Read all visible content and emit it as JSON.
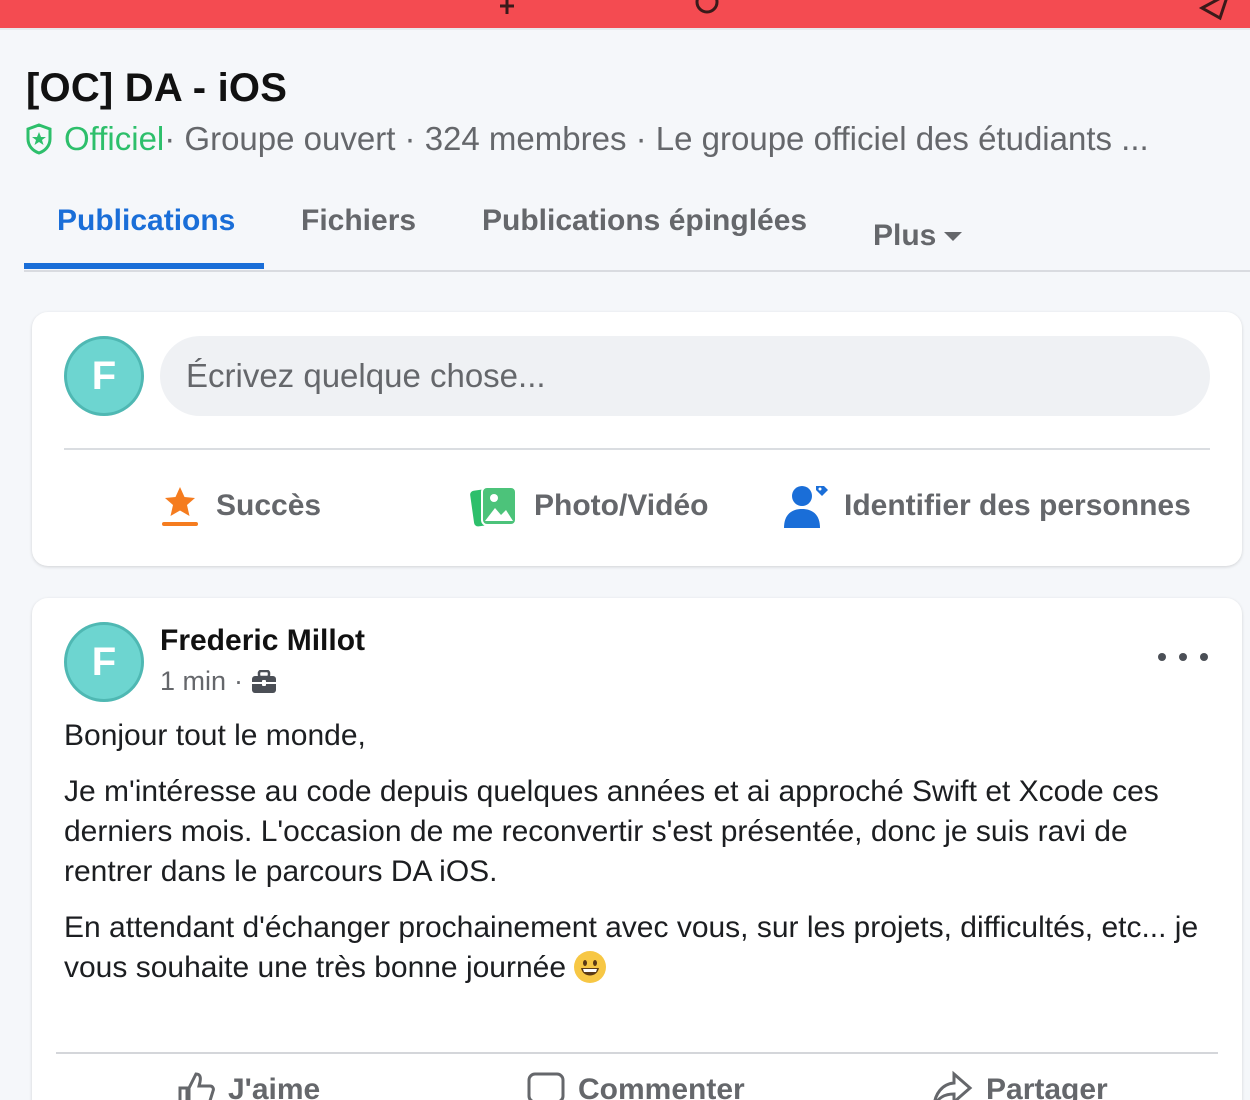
{
  "status_bar": {
    "color": "#f44b51"
  },
  "group": {
    "title": "[OC] DA - iOS",
    "official_label": "Officiel",
    "meta": " · Groupe ouvert · 324 membres · Le groupe officiel des étudiants ..."
  },
  "tabs": [
    {
      "label": "Publications",
      "active": true
    },
    {
      "label": "Fichiers"
    },
    {
      "label": "Publications épinglées"
    },
    {
      "label": "Plus"
    }
  ],
  "composer": {
    "avatar_initial": "F",
    "placeholder": "Écrivez quelque chose...",
    "actions": [
      {
        "label": "Succès",
        "icon": "star-badge-icon"
      },
      {
        "label": "Photo/Vidéo",
        "icon": "photo-icon"
      },
      {
        "label": "Identifier des personnes",
        "icon": "tag-person-icon"
      }
    ]
  },
  "post": {
    "avatar_initial": "F",
    "author": "Frederic Millot",
    "time": "1 min",
    "time_sep": "·",
    "audience_icon": "work-group-icon",
    "paragraphs": [
      "Bonjour tout le monde,",
      "Je m'intéresse au code depuis quelques années et ai approché Swift et Xcode ces derniers mois. L'occasion de me reconvertir s'est présentée, donc je suis ravi de rentrer dans le parcours DA iOS.",
      "En attendant d'échanger prochainement avec vous, sur les projets, difficultés, etc... je vous souhaite une très bonne journée"
    ],
    "actions": [
      {
        "label": "J'aime",
        "icon": "thumbs-up-icon"
      },
      {
        "label": "Commenter",
        "icon": "comment-icon"
      },
      {
        "label": "Partager",
        "icon": "share-icon"
      }
    ]
  },
  "colors": {
    "accent": "#1a6ed8",
    "official": "#2dbf6b",
    "avatar": "#6dd5d0"
  }
}
